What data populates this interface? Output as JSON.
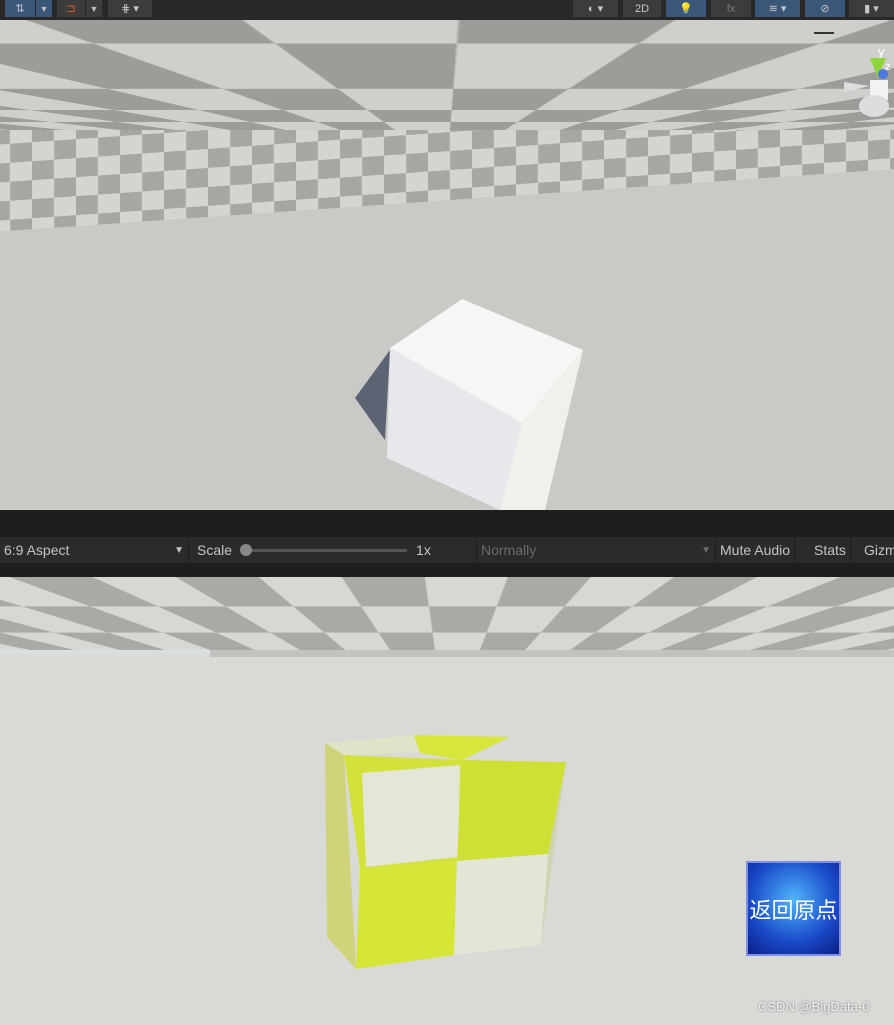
{
  "scene_toolbar": {
    "tools": [
      {
        "icon": "transform-tool-icon",
        "active": true
      },
      {
        "icon": "snap-magnet-icon"
      },
      {
        "icon": "grid-icon"
      }
    ],
    "right": [
      {
        "icon": "shading-mode-icon"
      },
      {
        "label": "2D"
      },
      {
        "icon": "lighting-bulb-icon",
        "active": true
      },
      {
        "icon": "effects-icon"
      },
      {
        "icon": "layers-icon",
        "active": true
      },
      {
        "icon": "visibility-eye-icon",
        "active": true
      },
      {
        "icon": "camera-icon"
      }
    ]
  },
  "scene_gizmo": {
    "axes": [
      "y",
      "z"
    ]
  },
  "game_toolbar": {
    "aspect": "6:9 Aspect",
    "scale_label": "Scale",
    "scale_value": "1x",
    "play_mode": "Normally",
    "mute_audio": "Mute Audio",
    "stats": "Stats",
    "gizmos": "Gizm"
  },
  "game_view": {
    "button_label": "返回原点",
    "watermark": "CSDN @BigData-0"
  },
  "colors": {
    "accent": "#3a5678",
    "cube_yellow": "#d6e630"
  }
}
